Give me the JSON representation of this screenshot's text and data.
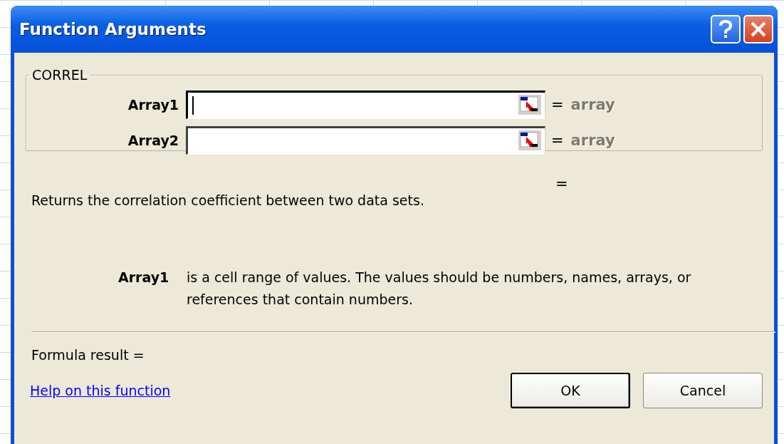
{
  "window": {
    "title": "Function Arguments"
  },
  "function_group": {
    "name": "CORREL",
    "arguments": [
      {
        "label": "Array1",
        "focused": true,
        "equals": "=",
        "result": "array"
      },
      {
        "label": "Array2",
        "focused": false,
        "equals": "=",
        "result": "array"
      }
    ]
  },
  "total_result": "=",
  "description": "Returns the correlation coefficient between two data sets.",
  "argument_help": {
    "name": "Array1",
    "text": "is a cell range of values. The values should be numbers, names, arrays, or references that contain numbers."
  },
  "formula_result": "Formula result =",
  "help_link": "Help on this function",
  "buttons": [
    {
      "label": "OK",
      "default": true
    },
    {
      "label": "Cancel",
      "default": false
    }
  ]
}
